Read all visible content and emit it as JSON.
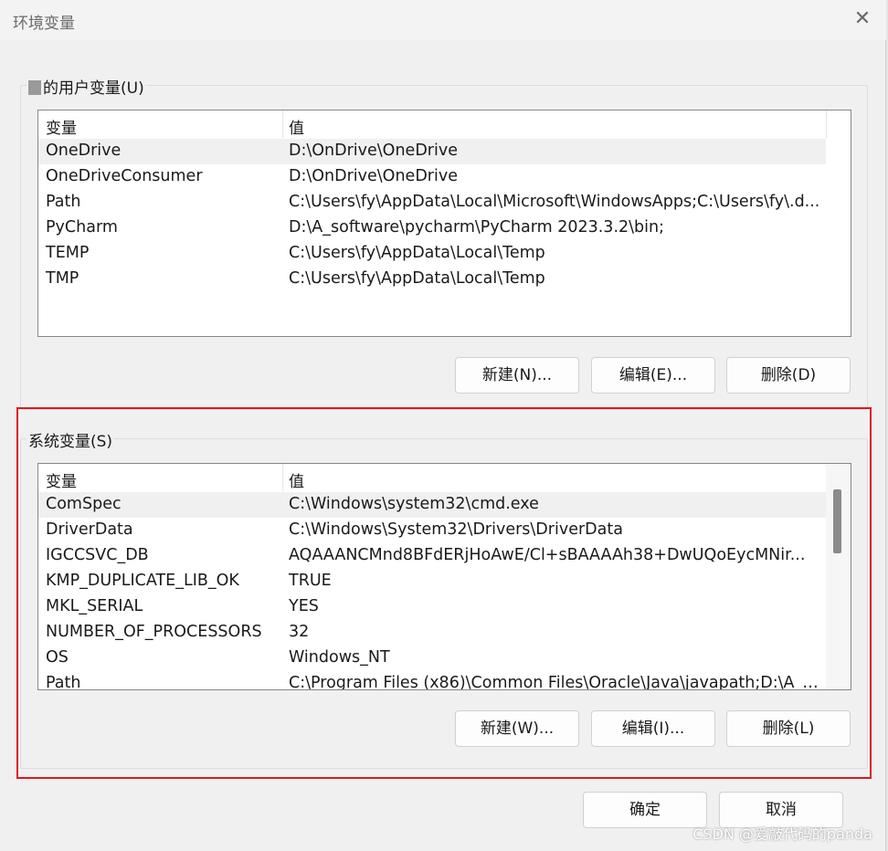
{
  "window": {
    "title": "环境变量",
    "close_glyph": "✕"
  },
  "user_vars": {
    "legend": "的用户变量(U)",
    "headers": [
      "变量",
      "值"
    ],
    "rows": [
      {
        "name": "OneDrive",
        "value": "D:\\OnDrive\\OneDrive"
      },
      {
        "name": "OneDriveConsumer",
        "value": "D:\\OnDrive\\OneDrive"
      },
      {
        "name": "Path",
        "value": "C:\\Users\\fy\\AppData\\Local\\Microsoft\\WindowsApps;C:\\Users\\fy\\.d..."
      },
      {
        "name": "PyCharm",
        "value": "D:\\A_software\\pycharm\\PyCharm 2023.3.2\\bin;"
      },
      {
        "name": "TEMP",
        "value": "C:\\Users\\fy\\AppData\\Local\\Temp"
      },
      {
        "name": "TMP",
        "value": "C:\\Users\\fy\\AppData\\Local\\Temp"
      }
    ],
    "new_label": "新建(N)...",
    "edit_label": "编辑(E)...",
    "delete_label": "删除(D)"
  },
  "sys_vars": {
    "legend": "系统变量(S)",
    "headers": [
      "变量",
      "值"
    ],
    "rows": [
      {
        "name": "ComSpec",
        "value": "C:\\Windows\\system32\\cmd.exe"
      },
      {
        "name": "DriverData",
        "value": "C:\\Windows\\System32\\Drivers\\DriverData"
      },
      {
        "name": "IGCCSVC_DB",
        "value": "AQAAANCMnd8BFdERjHoAwE/Cl+sBAAAAh38+DwUQoEycMNir..."
      },
      {
        "name": "KMP_DUPLICATE_LIB_OK",
        "value": "TRUE"
      },
      {
        "name": "MKL_SERIAL",
        "value": "YES"
      },
      {
        "name": "NUMBER_OF_PROCESSORS",
        "value": "32"
      },
      {
        "name": "OS",
        "value": "Windows_NT"
      },
      {
        "name": "Path",
        "value": "C:\\Program Files (x86)\\Common Files\\Oracle\\Java\\javapath;D:\\A_s..."
      }
    ],
    "new_label": "新建(W)...",
    "edit_label": "编辑(I)...",
    "delete_label": "删除(L)"
  },
  "footer": {
    "ok_label": "确定",
    "cancel_label": "取消"
  },
  "watermark": "CSDN @爱敲代码的panda",
  "colors": {
    "highlight": "#e0161f",
    "dialog_bg": "#f0f0f0"
  }
}
